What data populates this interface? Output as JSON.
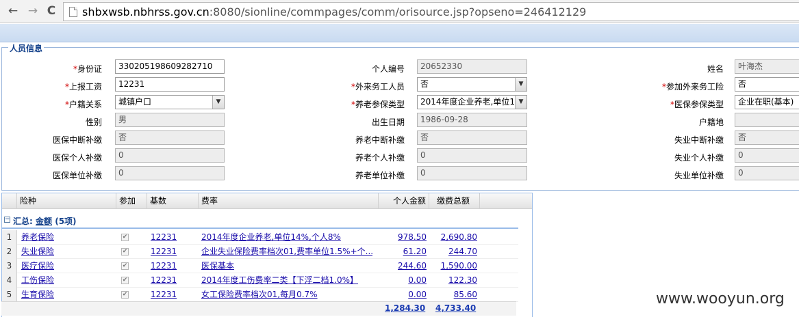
{
  "browser": {
    "back": "←",
    "forward": "→",
    "reload": "C",
    "url_host": "shbxwsb.nbhrss.gov.cn",
    "url_rest": ":8080/sionline/commpages/comm/orisource.jsp?opseno=246412129"
  },
  "section_title": "人员信息",
  "required_mark": "*",
  "fields": {
    "id_card": {
      "label": "身份证",
      "value": "330205198609282710"
    },
    "person_no": {
      "label": "个人编号",
      "value": "20652330"
    },
    "name": {
      "label": "姓名",
      "value": "叶海杰"
    },
    "report_wage": {
      "label": "上报工资",
      "value": "12231"
    },
    "migrant_worker": {
      "label": "外来务工人员",
      "value": "否"
    },
    "join_migrant_insurance": {
      "label": "参加外来务工险",
      "value": "否"
    },
    "household": {
      "label": "户籍关系",
      "value": "城镇户口"
    },
    "pension_type": {
      "label": "养老参保类型",
      "value": "2014年度企业养老,单位1"
    },
    "medical_type": {
      "label": "医保参保类型",
      "value": "企业在职(基本)"
    },
    "gender": {
      "label": "性别",
      "value": "男"
    },
    "birth_date": {
      "label": "出生日期",
      "value": "1986-09-28"
    },
    "household_place": {
      "label": "户籍地",
      "value": ""
    },
    "med_interrupt": {
      "label": "医保中断补缴",
      "value": "否"
    },
    "pension_interrupt": {
      "label": "养老中断补缴",
      "value": "否"
    },
    "unemp_interrupt": {
      "label": "失业中断补缴",
      "value": "否"
    },
    "med_personal": {
      "label": "医保个人补缴",
      "value": "0"
    },
    "pension_personal": {
      "label": "养老个人补缴",
      "value": "0"
    },
    "unemp_personal": {
      "label": "失业个人补缴",
      "value": "0"
    },
    "med_unit": {
      "label": "医保单位补缴",
      "value": "0"
    },
    "pension_unit": {
      "label": "养老单位补缴",
      "value": "0"
    },
    "unemp_unit": {
      "label": "失业单位补缴",
      "value": "0"
    }
  },
  "grid": {
    "columns": [
      "险种",
      "参加",
      "基数",
      "费率",
      "个人金额",
      "缴费总额"
    ],
    "group": {
      "prefix": "汇总:",
      "link": "金额",
      "count": "(5项)"
    },
    "rows": [
      {
        "no": "1",
        "type": "养老保险",
        "base": "12231",
        "rate": "2014年度企业养老,单位14%,个人8%",
        "personal": "978.50",
        "total": "2,690.80"
      },
      {
        "no": "2",
        "type": "失业保险",
        "base": "12231",
        "rate": "企业失业保险费率档次01,费率单位1.5%+个...",
        "personal": "61.20",
        "total": "244.70"
      },
      {
        "no": "3",
        "type": "医疗保险",
        "base": "12231",
        "rate": "医保基本",
        "personal": "244.60",
        "total": "1,590.00"
      },
      {
        "no": "4",
        "type": "工伤保险",
        "base": "12231",
        "rate": "2014年度工伤费率二类【下浮二档1.0%】",
        "personal": "0.00",
        "total": "122.30"
      },
      {
        "no": "5",
        "type": "生育保险",
        "base": "12231",
        "rate": "女工保险费率档次01,每月0.7%",
        "personal": "0.00",
        "total": "85.60"
      }
    ],
    "sum_personal": "1,284.30",
    "sum_total": "4,733.40"
  },
  "watermark": "www.wooyun.org"
}
